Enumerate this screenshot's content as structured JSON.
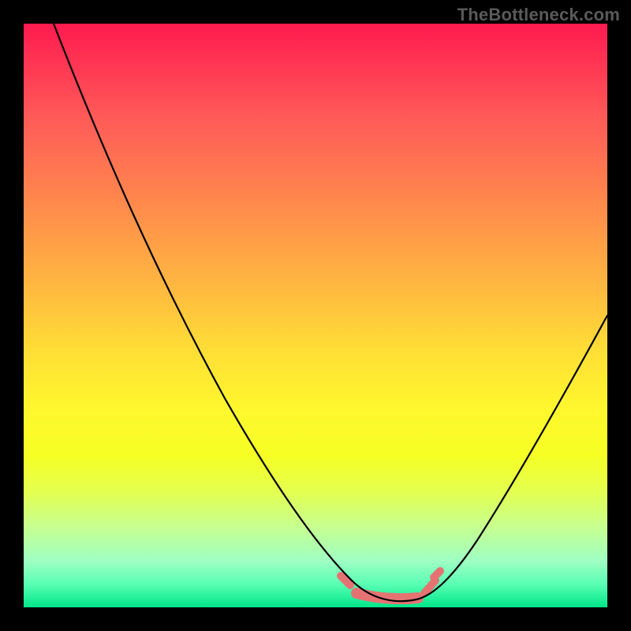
{
  "watermark": "TheBottleneck.com",
  "colors": {
    "frame": "#000000",
    "curve": "#000000",
    "band": "#e57373",
    "gradient_top": "#ff1a4f",
    "gradient_bottom": "#00e68a"
  },
  "chart_data": {
    "type": "line",
    "title": "",
    "xlabel": "",
    "ylabel": "",
    "xlim": [
      0,
      100
    ],
    "ylim": [
      0,
      100
    ],
    "grid": false,
    "legend": false,
    "series": [
      {
        "name": "bottleneck-curve",
        "x": [
          5,
          10,
          15,
          20,
          25,
          30,
          35,
          40,
          45,
          50,
          55,
          58,
          60,
          62,
          65,
          68,
          70,
          75,
          80,
          85,
          90,
          95,
          100
        ],
        "y": [
          100,
          90,
          80,
          70,
          60,
          50,
          41,
          32,
          24,
          16,
          9,
          5,
          3,
          2,
          1,
          1,
          2,
          6,
          13,
          22,
          33,
          45,
          58
        ]
      }
    ],
    "highlight_band": {
      "name": "optimal-range",
      "x_start": 55,
      "x_end": 72,
      "y": 1
    },
    "background_gradient": {
      "description": "vertical red-to-green heat gradient indicating bottleneck severity",
      "stops": [
        {
          "pos": 0.0,
          "color": "#ff1a4f"
        },
        {
          "pos": 0.5,
          "color": "#ffde36"
        },
        {
          "pos": 1.0,
          "color": "#00e68a"
        }
      ]
    }
  }
}
